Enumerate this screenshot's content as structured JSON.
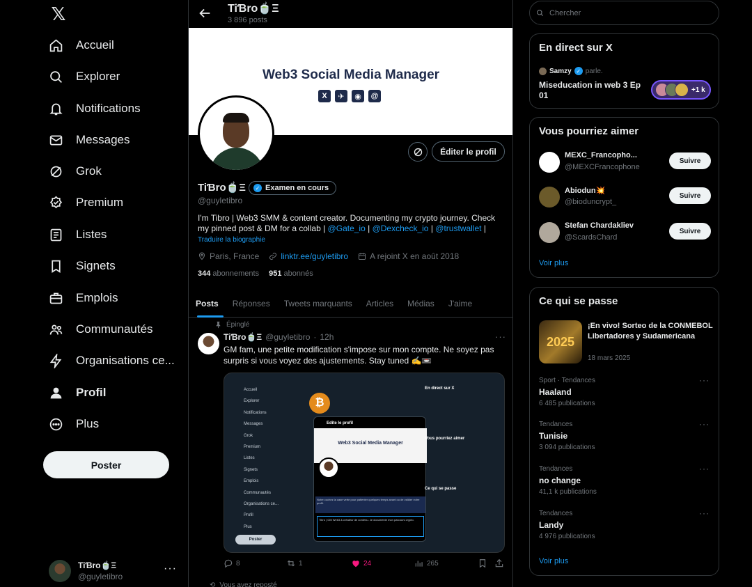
{
  "app": {
    "logo": "𝕏"
  },
  "nav": {
    "items": [
      {
        "label": "Accueil",
        "icon": "home-icon"
      },
      {
        "label": "Explorer",
        "icon": "search-icon"
      },
      {
        "label": "Notifications",
        "icon": "bell-icon"
      },
      {
        "label": "Messages",
        "icon": "mail-icon"
      },
      {
        "label": "Grok",
        "icon": "grok-icon"
      },
      {
        "label": "Premium",
        "icon": "premium-icon"
      },
      {
        "label": "Listes",
        "icon": "list-icon"
      },
      {
        "label": "Signets",
        "icon": "bookmark-icon"
      },
      {
        "label": "Emplois",
        "icon": "briefcase-icon"
      },
      {
        "label": "Communautés",
        "icon": "communities-icon"
      },
      {
        "label": "Organisations ce...",
        "icon": "lightning-icon"
      },
      {
        "label": "Profil",
        "icon": "profile-icon"
      },
      {
        "label": "Plus",
        "icon": "more-circle-icon"
      }
    ],
    "post_button": "Poster",
    "account": {
      "name": "TiƁro🍵Ξ",
      "handle": "@guyletibro",
      "more": "···"
    }
  },
  "header": {
    "title": "TiƁro🍵Ξ",
    "posts_count": "3 896 posts"
  },
  "banner": {
    "title": "Web3 Social Media Manager",
    "icons": [
      "X",
      "✈",
      "◉",
      "@"
    ]
  },
  "profile": {
    "edit_button": "Éditer le profil",
    "name": "TiƁro🍵Ξ",
    "badge": "Examen en cours",
    "handle": "@guyletibro",
    "bio_text": "I'm Tibro | Web3 SMM & content creator. Documenting my crypto journey. Check my pinned post & DM for a collab |",
    "bio_link1": "@Gate_io",
    "bio_sep1": "|",
    "bio_link2": "@Dexcheck_io",
    "bio_sep2": "|",
    "bio_link3": "@trustwallet",
    "bio_sep3": "|",
    "translate": "Traduire la biographie",
    "location": "Paris, France",
    "website": "linktr.ee/guyletibro",
    "joined": "A rejoint X en août 2018",
    "following_count": "344",
    "following_label": "abonnements",
    "followers_count": "951",
    "followers_label": "abonnés"
  },
  "tabs": [
    "Posts",
    "Réponses",
    "Tweets marquants",
    "Articles",
    "Médias",
    "J'aime"
  ],
  "post": {
    "pinned_label": "Épinglé",
    "author": "TiƁro🍵Ξ",
    "handle": "@guyletibro",
    "sep": "·",
    "time": "12h",
    "text": "GM fam, une petite modification s'impose sur mon compte. Ne soyez pas surpris si vous voyez des ajustements. Stay tuned ✍️📼",
    "more": "···",
    "replies": "8",
    "reposts": "1",
    "likes": "24",
    "views": "265",
    "media": {
      "side_items": [
        "Accueil",
        "Explorer",
        "Notifications",
        "Messages",
        "Grok",
        "Premium",
        "Listes",
        "Signets",
        "Emplois",
        "Communautés",
        "Organisations ce...",
        "Profil",
        "Plus"
      ],
      "post_button": "Poster",
      "modal_title": "Edite le profil",
      "modal_banner": "Web3 Social Media Manager",
      "modal_note": "Notre cochez la case verte pour patienter quelques temps avant ou de valider votre profil.",
      "modal_bio": "Tibro | GM Web3 & créateur de contenu. Je documente mon parcours crypto.",
      "bitcoin": "₿",
      "right_title": "En direct sur X",
      "right_trends": "Ce qui se passe",
      "right_suggest": "Vous pourriez aimer"
    }
  },
  "next_post": {
    "retweeted": "Vous avez reposté"
  },
  "search": {
    "placeholder": "Chercher"
  },
  "live": {
    "heading": "En direct sur X",
    "host": "Samzy",
    "host_action": "parle.",
    "title": "Miseducation in web 3 Ep 01",
    "listeners": "+1 k"
  },
  "who_to_follow": {
    "heading": "Vous pourriez aimer",
    "users": [
      {
        "name": "MEXC_Francopho...",
        "handle": "@MEXCFrancophone",
        "button": "Suivre",
        "avatar_color": "#ffffff"
      },
      {
        "name": "Abiodun💥",
        "handle": "@bioduncrypt_",
        "button": "Suivre",
        "avatar_color": "#6b5a2a"
      },
      {
        "name": "Stefan Chardakliev",
        "handle": "@ScardsChard",
        "button": "Suivre",
        "avatar_color": "#b0a89c"
      }
    ],
    "see_more": "Voir plus"
  },
  "trends": {
    "heading": "Ce qui se passe",
    "news": {
      "title": "¡En vivo! Sorteo de la CONMEBOL Libertadores y Sudamericana",
      "date": "18 mars 2025",
      "image_text": "2025"
    },
    "items": [
      {
        "category": "Sport · Tendances",
        "name": "Haaland",
        "posts": "6 485 publications"
      },
      {
        "category": "Tendances",
        "name": "Tunisie",
        "posts": "3 094 publications"
      },
      {
        "category": "Tendances",
        "name": "no change",
        "posts": "41,1 k publications"
      },
      {
        "category": "Tendances",
        "name": "Landy",
        "posts": "4 976 publications"
      }
    ],
    "more": "···",
    "see_more": "Voir plus"
  },
  "colors": {
    "accent": "#1d9bf0",
    "like": "#f91880",
    "background": "#000000",
    "border": "#2f3336"
  }
}
